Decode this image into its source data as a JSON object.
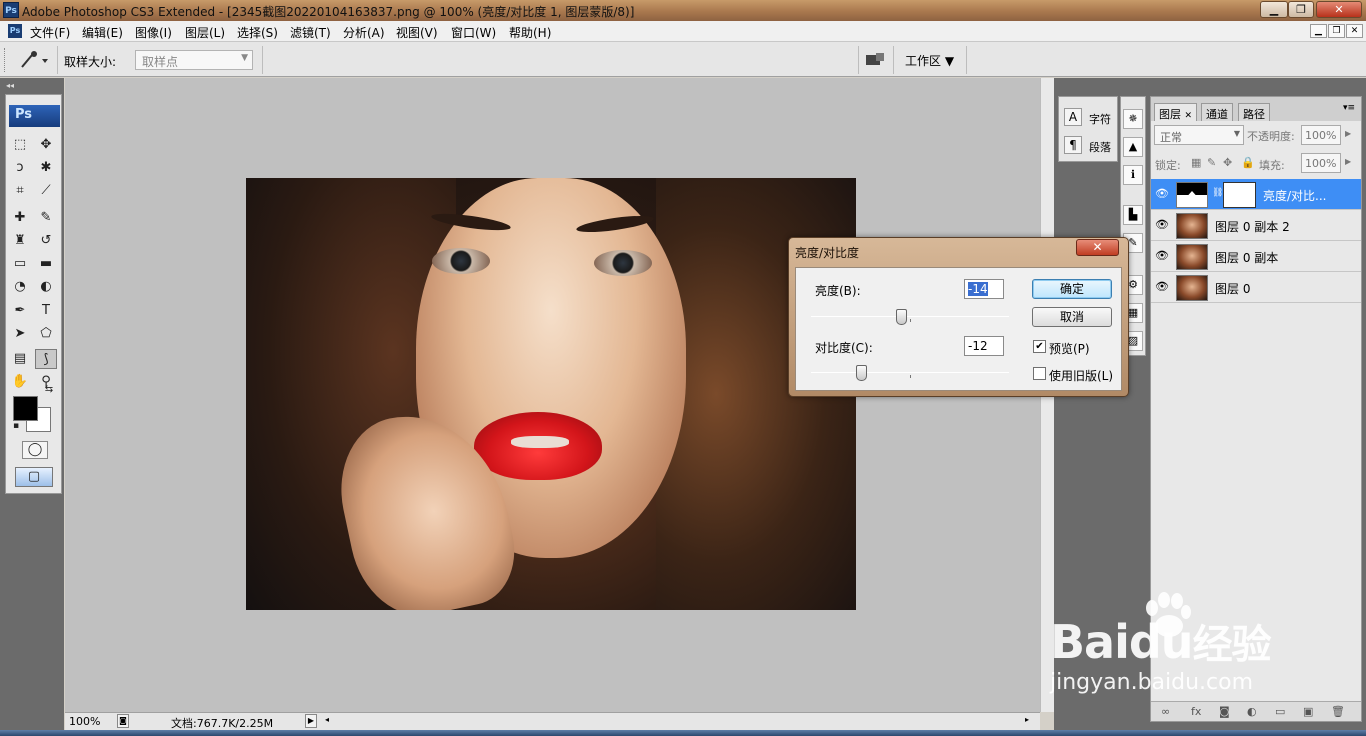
{
  "window": {
    "title": "Adobe Photoshop CS3 Extended - [2345截图20220104163837.png @ 100% (亮度/对比度 1, 图层蒙版/8)]",
    "logo": "Ps",
    "controls": {
      "minimize": "▁",
      "maximize": "❐",
      "close": "✕"
    }
  },
  "menubar": {
    "items": [
      "文件(F)",
      "编辑(E)",
      "图像(I)",
      "图层(L)",
      "选择(S)",
      "滤镜(T)",
      "分析(A)",
      "视图(V)",
      "窗口(W)",
      "帮助(H)"
    ],
    "doc_controls": [
      "▁",
      "❐",
      "✕"
    ]
  },
  "options": {
    "sample_size_label": "取样大小:",
    "sample_size_value": "取样点",
    "workspace_label": "工作区"
  },
  "toolbox": {
    "badge": "Ps",
    "tools": [
      {
        "name": "marquee-tool-icon",
        "glyph": "⬚"
      },
      {
        "name": "move-tool-icon",
        "glyph": "✥"
      },
      {
        "name": "lasso-tool-icon",
        "glyph": "ↄ"
      },
      {
        "name": "magic-wand-tool-icon",
        "glyph": "✱"
      },
      {
        "name": "crop-tool-icon",
        "glyph": "⌗"
      },
      {
        "name": "slice-tool-icon",
        "glyph": "⟋"
      },
      {
        "name": "healing-brush-tool-icon",
        "glyph": "✚"
      },
      {
        "name": "brush-tool-icon",
        "glyph": "✎"
      },
      {
        "name": "clone-stamp-tool-icon",
        "glyph": "♜"
      },
      {
        "name": "history-brush-tool-icon",
        "glyph": "↺"
      },
      {
        "name": "eraser-tool-icon",
        "glyph": "▭"
      },
      {
        "name": "gradient-tool-icon",
        "glyph": "▬"
      },
      {
        "name": "blur-tool-icon",
        "glyph": "◔"
      },
      {
        "name": "dodge-tool-icon",
        "glyph": "◐"
      },
      {
        "name": "pen-tool-icon",
        "glyph": "✒"
      },
      {
        "name": "type-tool-icon",
        "glyph": "T"
      },
      {
        "name": "path-selection-tool-icon",
        "glyph": "➤"
      },
      {
        "name": "shape-tool-icon",
        "glyph": "⬠"
      },
      {
        "name": "notes-tool-icon",
        "glyph": "▤"
      },
      {
        "name": "eyedropper-tool-icon",
        "glyph": "⟆"
      },
      {
        "name": "hand-tool-icon",
        "glyph": "✋"
      },
      {
        "name": "zoom-tool-icon",
        "glyph": "⚲"
      }
    ],
    "quick_mask_glyph": "◯",
    "screen_mode_glyph": "▢",
    "swap_glyph": "⇆",
    "default_colors_glyph": "▪"
  },
  "statusbar": {
    "zoom": "100%",
    "docinfo": "文档:767.7K/2.25M"
  },
  "char_panel": {
    "items": [
      {
        "icon": "A",
        "label": "字符"
      },
      {
        "icon": "¶",
        "label": "段落"
      }
    ]
  },
  "icon_strip": [
    "✵",
    "▲",
    "ℹ",
    "▙",
    "✎",
    "⚙",
    "▦",
    "▨"
  ],
  "layers_panel": {
    "tabs": [
      "图层",
      "通道",
      "路径"
    ],
    "tab_close": "✕",
    "blend_mode": "正常",
    "opacity_label": "不透明度:",
    "opacity_value": "100%",
    "lock_label": "锁定:",
    "fill_label": "填充:",
    "fill_value": "100%",
    "layers": [
      {
        "name": "亮度/对比...",
        "selected": true,
        "type": "adjustment"
      },
      {
        "name": "图层 0 副本 2",
        "selected": false,
        "type": "image"
      },
      {
        "name": "图层 0 副本",
        "selected": false,
        "type": "image"
      },
      {
        "name": "图层 0",
        "selected": false,
        "type": "image"
      }
    ],
    "eye_glyph": "👁",
    "footer_icons": [
      "∞",
      "fx",
      "◙",
      "◐",
      "▭",
      "▣",
      "🗑"
    ]
  },
  "dialog": {
    "title": "亮度/对比度",
    "close": "✕",
    "brightness_label": "亮度(B):",
    "brightness_value": "-14",
    "brightness_value_num": -14,
    "contrast_label": "对比度(C):",
    "contrast_value": "-12",
    "contrast_value_num": -12,
    "ok_label": "确定",
    "cancel_label": "取消",
    "preview_label": "预览(P)",
    "preview_checked": true,
    "legacy_label": "使用旧版(L)",
    "legacy_checked": false
  },
  "watermark": {
    "brand": "Bai",
    "brand_tail": "经验",
    "brand_mid": "du",
    "url": "jingyan.baidu.com"
  }
}
